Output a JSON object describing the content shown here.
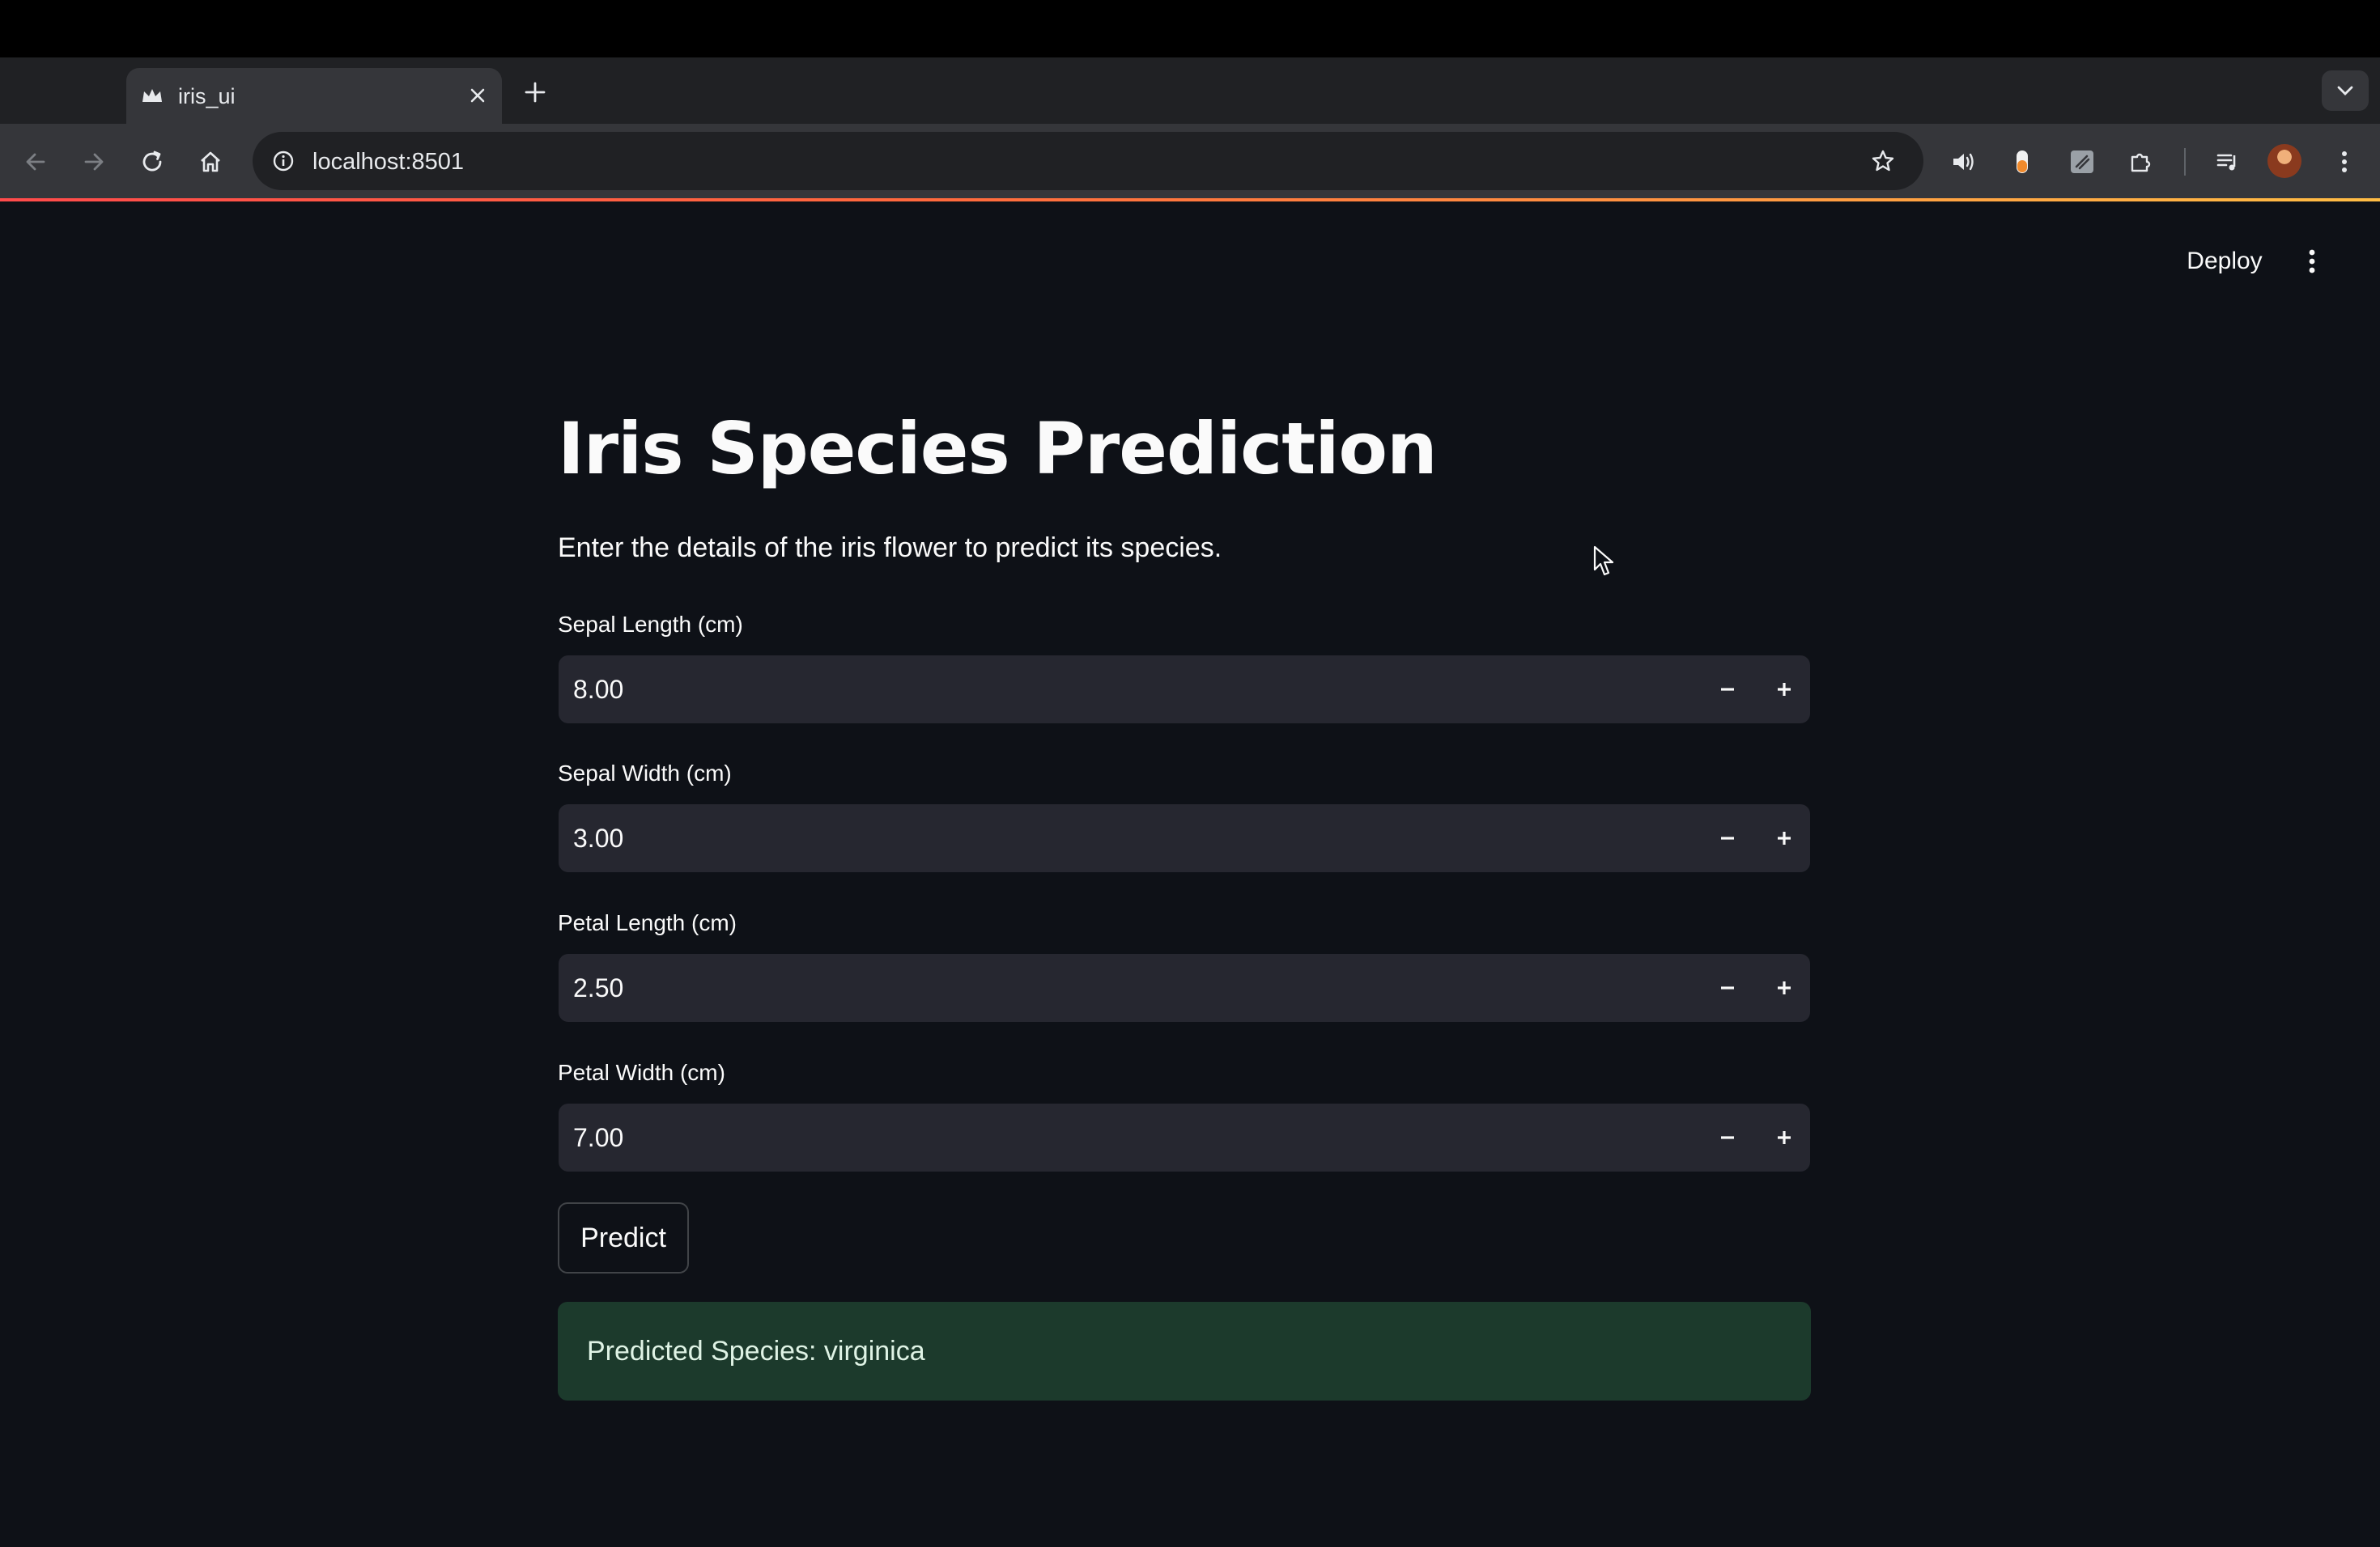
{
  "browser": {
    "tab": {
      "title": "iris_ui",
      "favicon": "streamlit-crown-icon"
    },
    "address_bar": {
      "url": "localhost:8501"
    },
    "icons": [
      "back-arrow-icon",
      "forward-arrow-icon",
      "reload-icon",
      "home-icon",
      "site-info-icon",
      "bookmark-star-icon",
      "speaker-icon",
      "extension-icon",
      "puzzle-icon",
      "media-queue-icon",
      "profile-avatar",
      "kebab-menu-icon"
    ]
  },
  "app": {
    "header": {
      "deploy_label": "Deploy",
      "menu_icon": "vertical-ellipsis-icon"
    },
    "title": "Iris Species Prediction",
    "subtitle": "Enter the details of the iris flower to predict its species.",
    "fields": [
      {
        "label": "Sepal Length (cm)",
        "value": "8.00"
      },
      {
        "label": "Sepal Width (cm)",
        "value": "3.00"
      },
      {
        "label": "Petal Length (cm)",
        "value": "2.50"
      },
      {
        "label": "Petal Width (cm)",
        "value": "7.00"
      }
    ],
    "predict_label": "Predict",
    "result": "Predicted Species: virginica"
  },
  "colors": {
    "app_background": "#0e1117",
    "input_background": "#262730",
    "success_background": "#1c3a2c",
    "text": "#fafafa",
    "accent": "#ff4b4b"
  }
}
